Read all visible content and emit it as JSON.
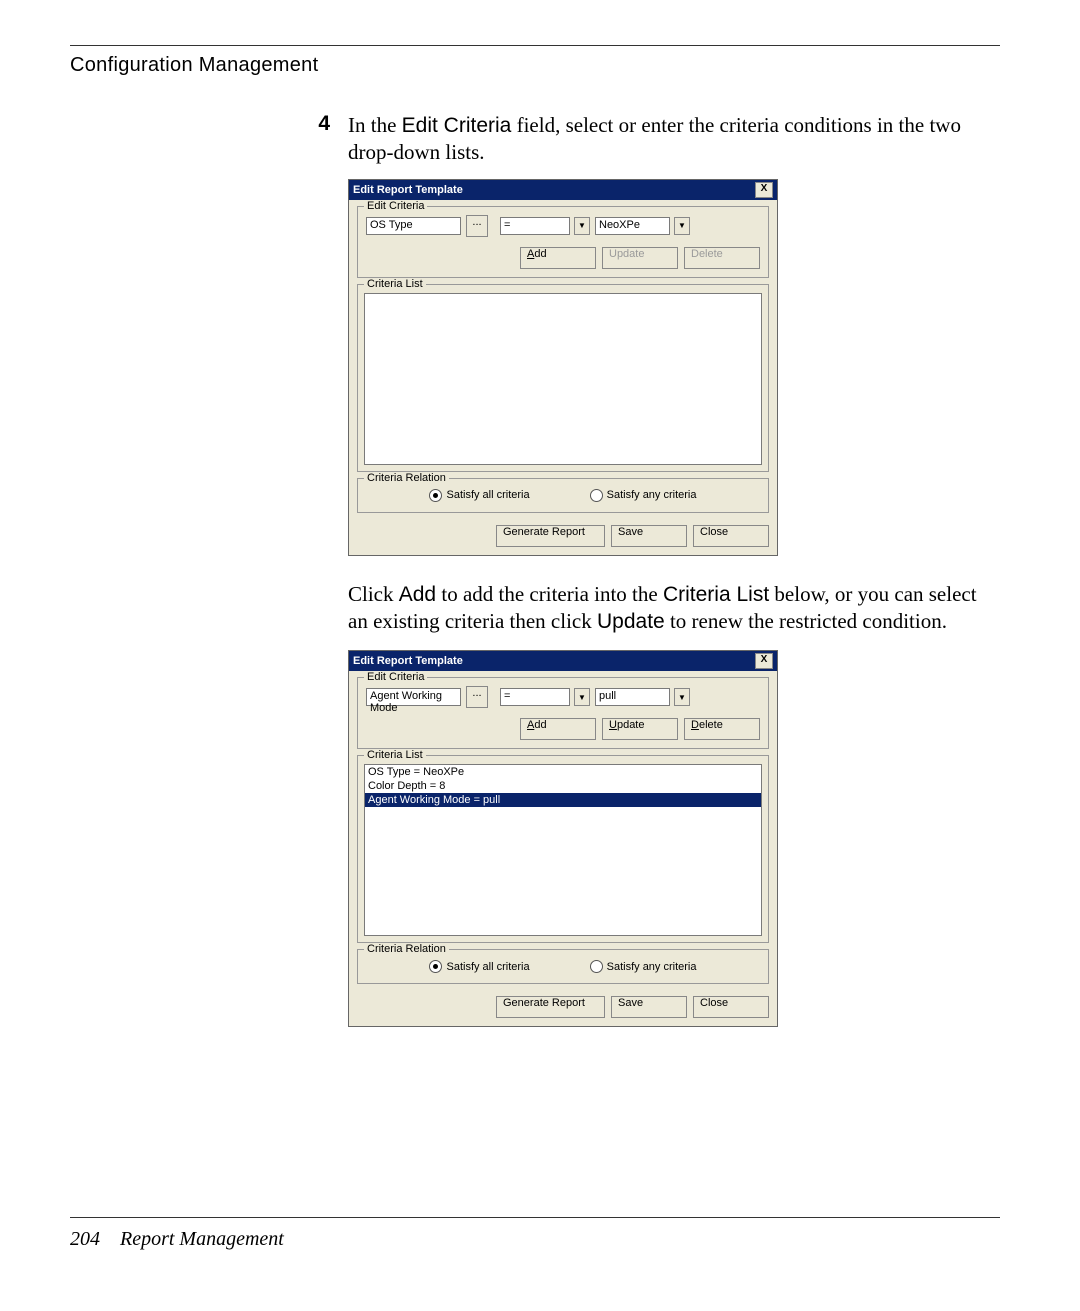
{
  "header": {
    "title": "Configuration Management"
  },
  "step": {
    "number": "4",
    "text_part1": "In the ",
    "text_label1": "Edit Criteria",
    "text_part2": " field, select or enter the criteria conditions in the two drop-down lists."
  },
  "dialog1": {
    "title": "Edit Report Template",
    "close": "X",
    "edit_legend": "Edit Criteria",
    "field1_value": "OS Type",
    "browse_btn": "...",
    "operator_value": "=",
    "field2_value": "NeoXPe",
    "btn_add": "Add",
    "btn_update": "Update",
    "btn_delete": "Delete",
    "list_legend": "Criteria List",
    "relation_legend": "Criteria Relation",
    "radio_all": "Satisfy all criteria",
    "radio_any": "Satisfy any criteria",
    "btn_generate": "Generate Report",
    "btn_save": "Save",
    "btn_close": "Close"
  },
  "para2": {
    "t1": "Click ",
    "l1": "Add",
    "t2": " to add the criteria into the ",
    "l2": "Criteria List",
    "t3": " below, or you can select an existing criteria then click ",
    "l3": "Update",
    "t4": " to renew the restricted condition."
  },
  "dialog2": {
    "title": "Edit Report Template",
    "close": "X",
    "edit_legend": "Edit Criteria",
    "field1_value": "Agent Working Mode",
    "browse_btn": "...",
    "operator_value": "=",
    "field2_value": "pull",
    "btn_add": "Add",
    "btn_update": "Update",
    "btn_delete": "Delete",
    "list_legend": "Criteria List",
    "list_items": {
      "0": "OS Type = NeoXPe",
      "1": "Color Depth = 8",
      "2": "Agent Working Mode = pull"
    },
    "relation_legend": "Criteria Relation",
    "radio_all": "Satisfy all criteria",
    "radio_any": "Satisfy any criteria",
    "btn_generate": "Generate Report",
    "btn_save": "Save",
    "btn_close": "Close"
  },
  "footer": {
    "page": "204",
    "section": "Report Management"
  }
}
